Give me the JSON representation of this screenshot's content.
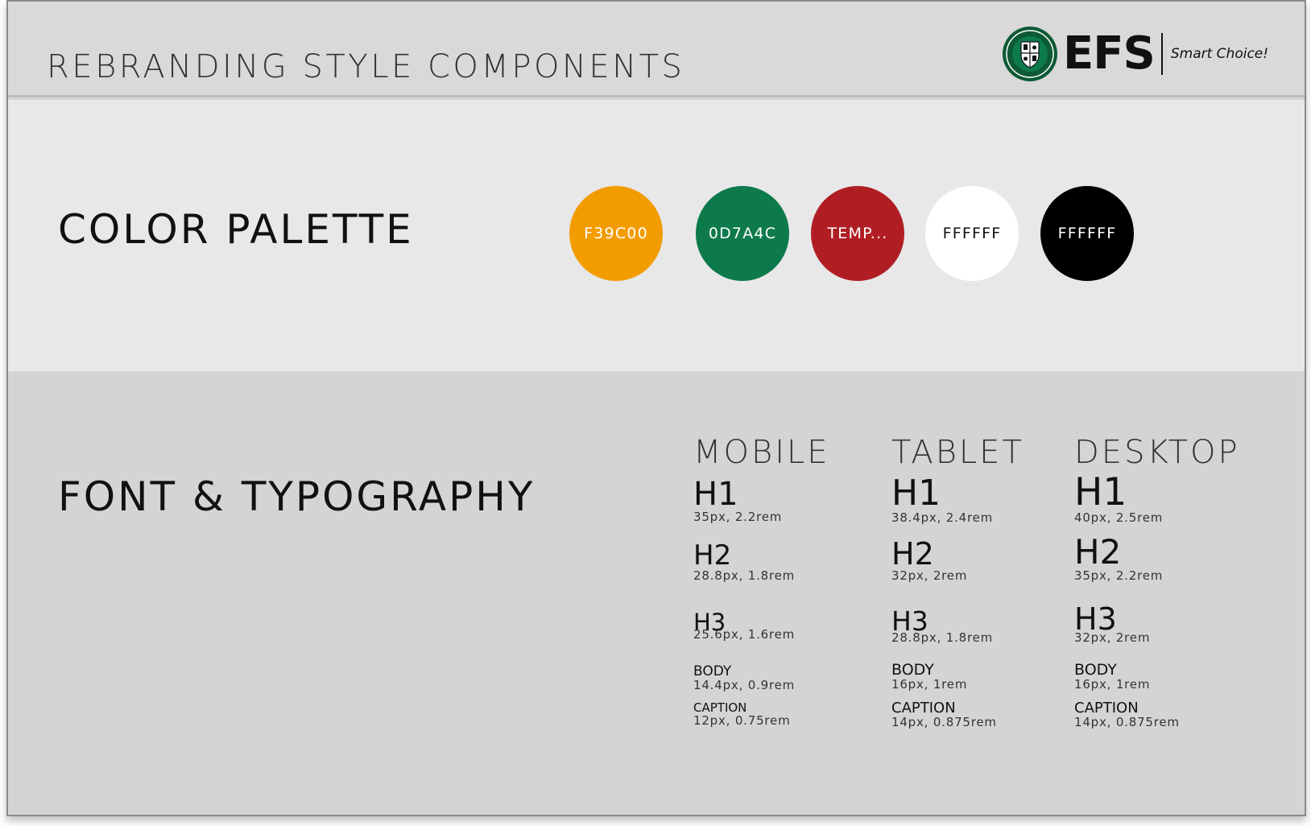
{
  "header": {
    "title": "REBRANDING STYLE COMPONENTS",
    "logo": {
      "seal_icon": "crest-seal-icon",
      "wordmark": "EFS",
      "tagline": "Smart Choice!"
    }
  },
  "palette": {
    "title": "COLOR PALETTE",
    "swatches": [
      {
        "label": "F39C00",
        "color": "#F39C00"
      },
      {
        "label": "0D7A4C",
        "color": "#0D7A4C"
      },
      {
        "label": "TEMP...",
        "color": "#B01E23"
      },
      {
        "label": "FFFFFF",
        "color": "#FFFFFF"
      },
      {
        "label": "FFFFFF",
        "color": "#000000"
      }
    ]
  },
  "typography": {
    "title": "FONT & TYPOGRAPHY",
    "columns": [
      {
        "heading": "MOBILE",
        "specs": [
          {
            "label": "H1",
            "size": "35px, 2.2rem"
          },
          {
            "label": "H2",
            "size": "28.8px, 1.8rem"
          },
          {
            "label": "H3",
            "size": "25.6px, 1.6rem"
          },
          {
            "label": "BODY",
            "size": "14.4px, 0.9rem"
          },
          {
            "label": "CAPTION",
            "size": "12px, 0.75rem"
          }
        ]
      },
      {
        "heading": "TABLET",
        "specs": [
          {
            "label": "H1",
            "size": "38.4px, 2.4rem"
          },
          {
            "label": "H2",
            "size": "32px, 2rem"
          },
          {
            "label": "H3",
            "size": "28.8px, 1.8rem"
          },
          {
            "label": "BODY",
            "size": "16px, 1rem"
          },
          {
            "label": "CAPTION",
            "size": "14px, 0.875rem"
          }
        ]
      },
      {
        "heading": "DESKTOP",
        "specs": [
          {
            "label": "H1",
            "size": "40px, 2.5rem"
          },
          {
            "label": "H2",
            "size": "35px, 2.2rem"
          },
          {
            "label": "H3",
            "size": "32px, 2rem"
          },
          {
            "label": "BODY",
            "size": "16px, 1rem"
          },
          {
            "label": "CAPTION",
            "size": "14px, 0.875rem"
          }
        ]
      }
    ]
  }
}
